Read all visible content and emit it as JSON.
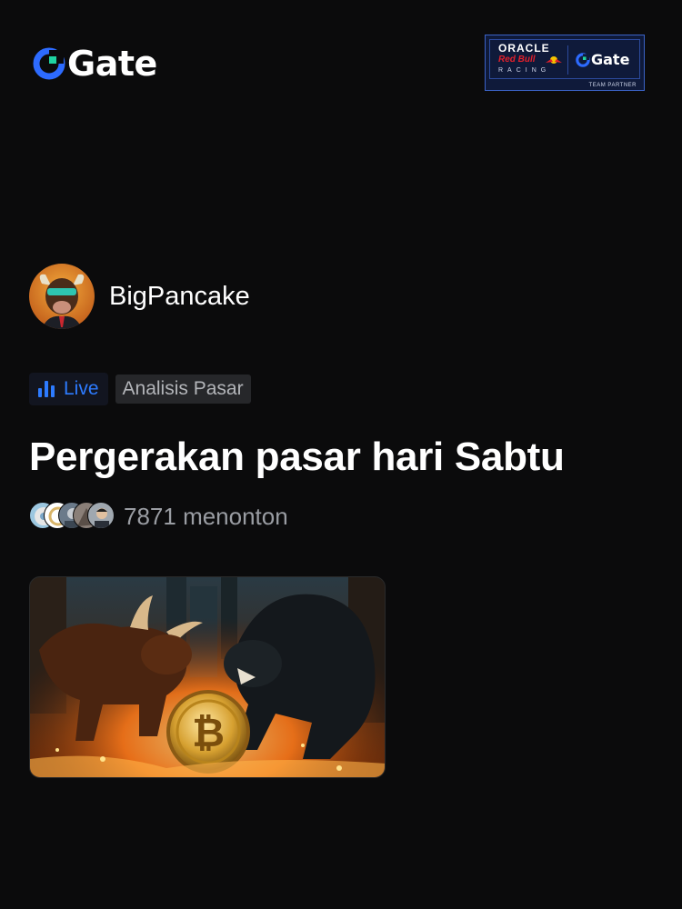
{
  "header": {
    "brand": "Gate",
    "partner": {
      "oracle": "ORACLE",
      "redbull": "Red Bull",
      "racing": "RACING",
      "gate": "Gate",
      "team": "TEAM PARTNER"
    }
  },
  "author": {
    "name": "BigPancake",
    "avatar_icon": "bull-avatar"
  },
  "tags": {
    "live_label": "Live",
    "category": "Analisis Pasar"
  },
  "title": "Pergerakan pasar hari Sabtu",
  "viewers": {
    "count_text": "7871 menonton"
  },
  "thumbnail": {
    "description_icon": "bull-vs-bear-bitcoin-image"
  },
  "colors": {
    "background": "#0b0b0c",
    "accent_blue": "#2d7bff",
    "gate_green": "#1fd3a2"
  }
}
